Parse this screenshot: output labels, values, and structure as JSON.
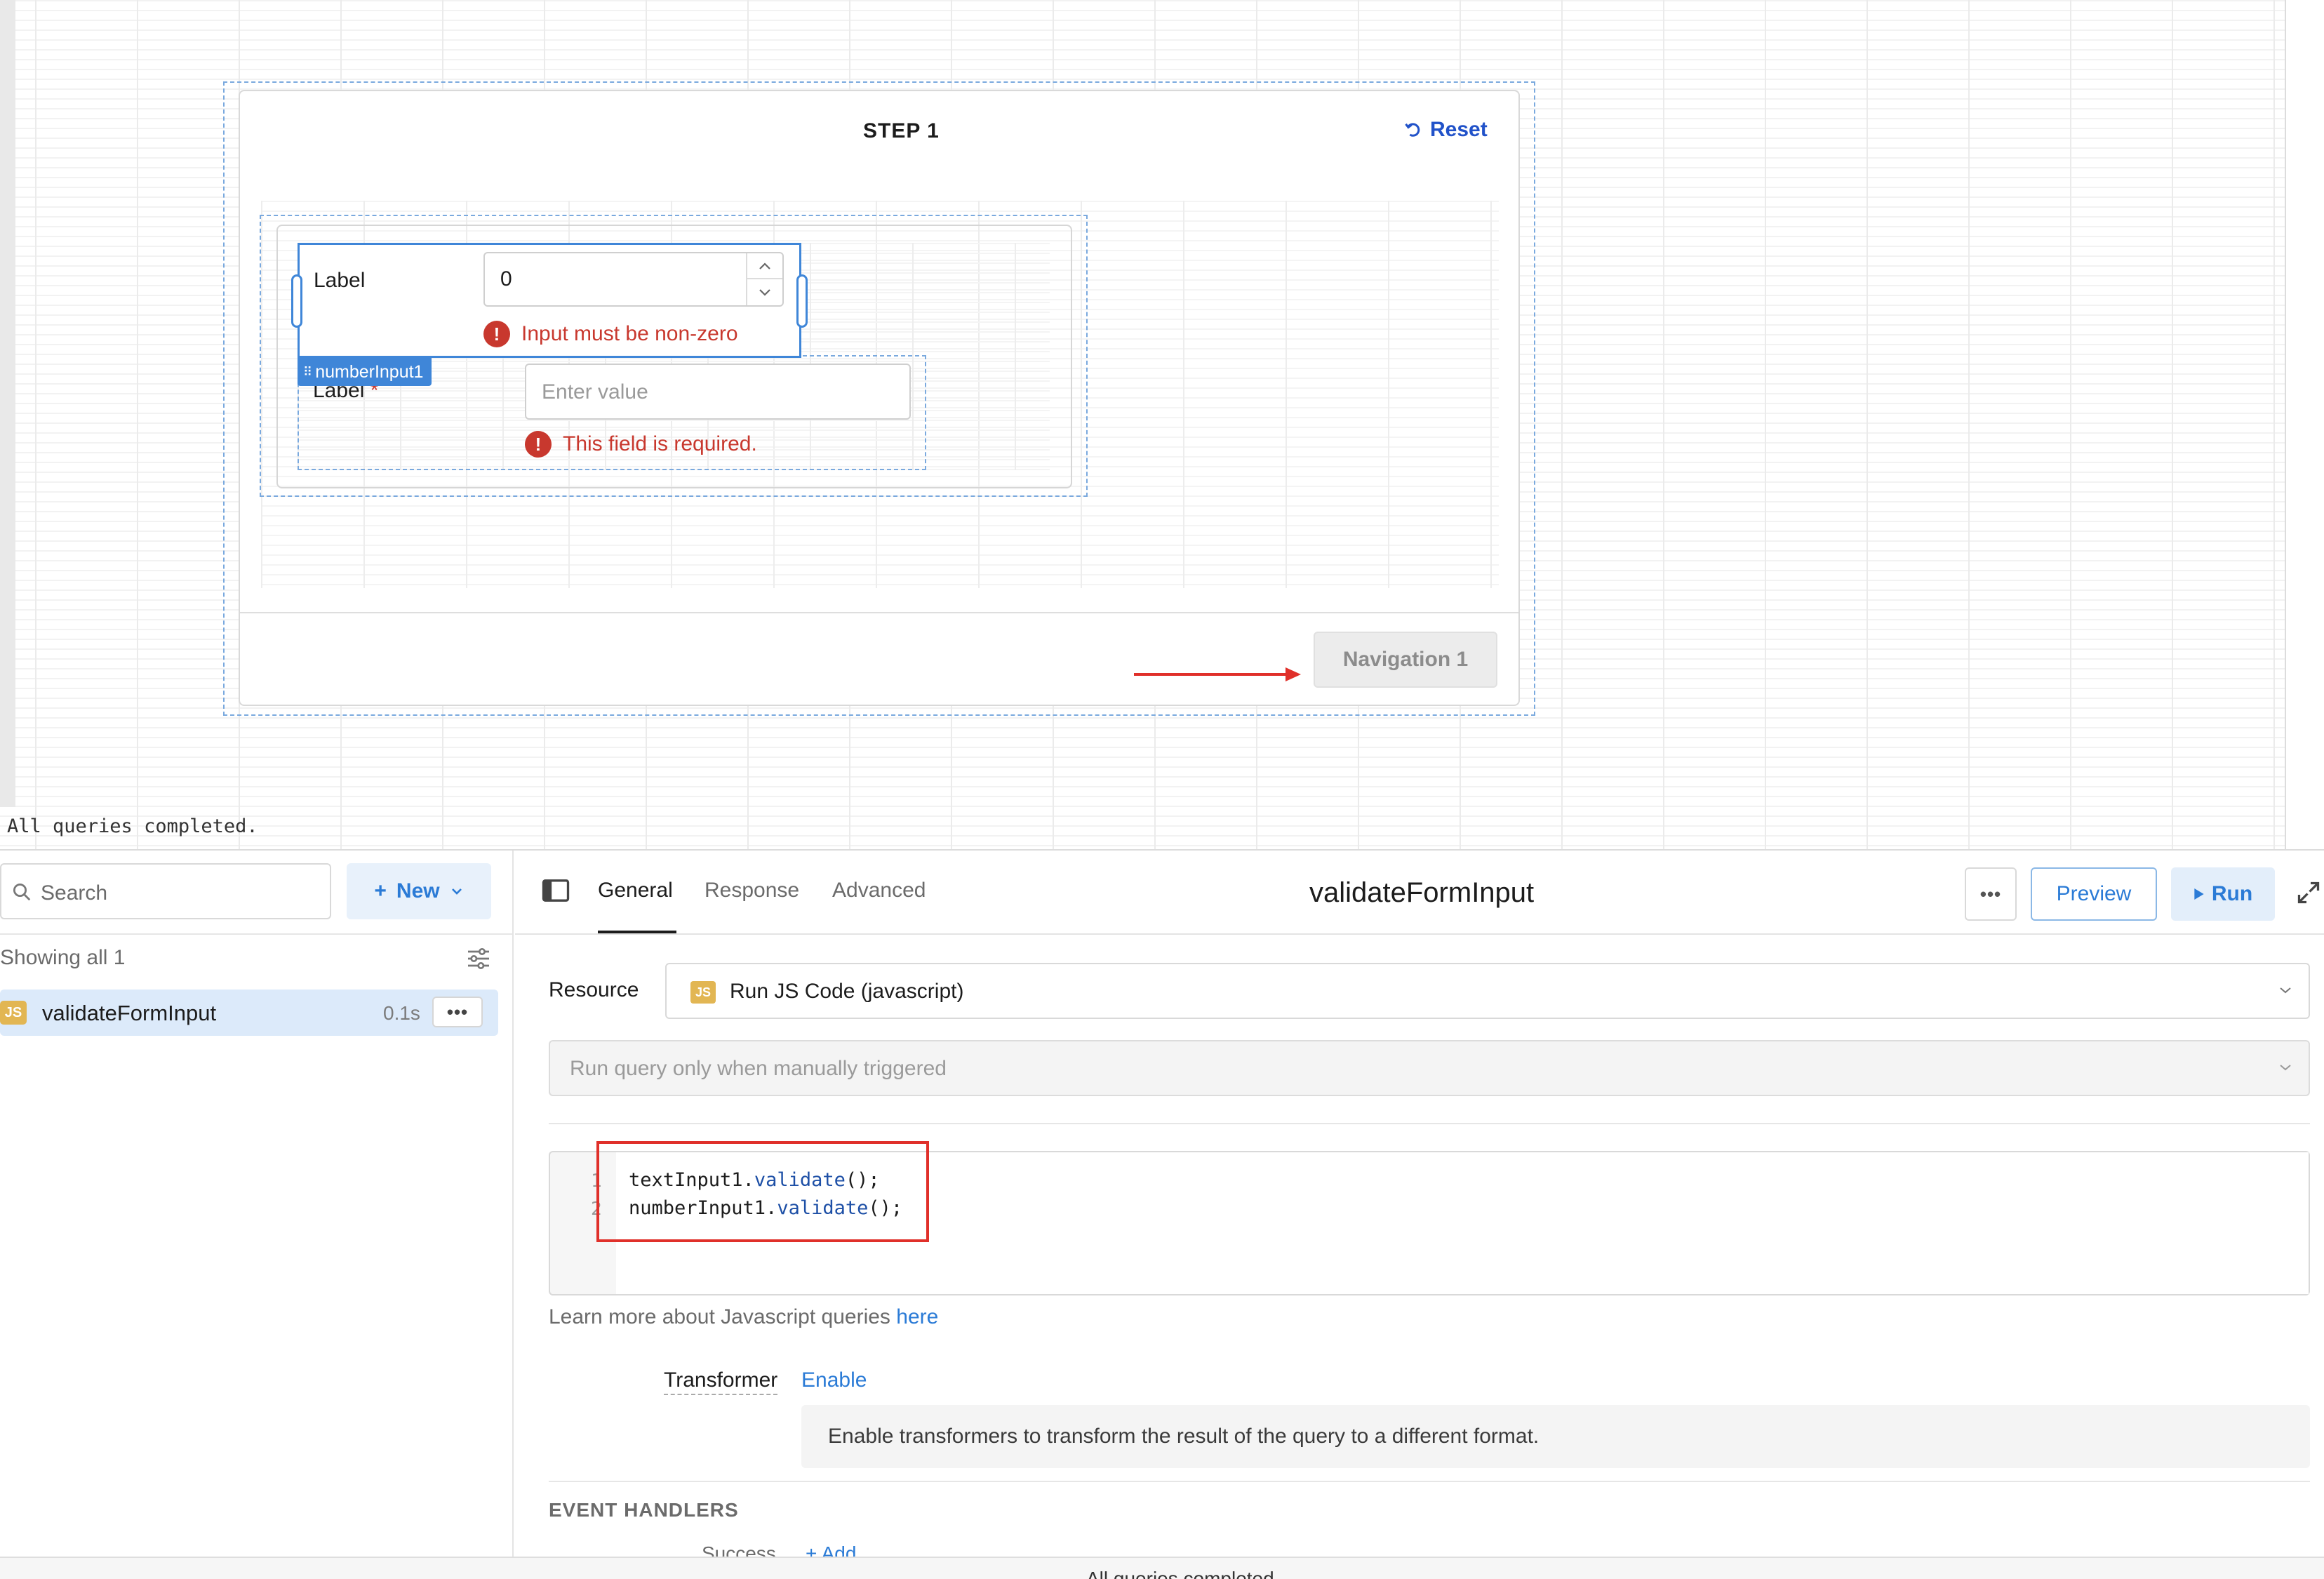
{
  "canvas": {
    "step_title": "STEP 1",
    "reset_label": "Reset",
    "number_input": {
      "label": "Label",
      "value": "0",
      "error": "Input must be non-zero",
      "component_tag": "numberInput1"
    },
    "text_input": {
      "label": "Label",
      "required_mark": "*",
      "placeholder": "Enter value",
      "error": "This field is required."
    },
    "navigation_button": "Navigation 1",
    "status": "All queries completed."
  },
  "query_list": {
    "search_placeholder": "Search",
    "new_label": "New",
    "showing": "Showing all 1",
    "items": [
      {
        "badge": "JS",
        "name": "validateFormInput",
        "time": "0.1s"
      }
    ]
  },
  "editor": {
    "tabs": [
      "General",
      "Response",
      "Advanced"
    ],
    "active_tab": "General",
    "title": "validateFormInput",
    "preview_label": "Preview",
    "run_label": "Run",
    "resource_label": "Resource",
    "resource_badge": "JS",
    "resource_value": "Run JS Code (javascript)",
    "trigger_value": "Run query only when manually triggered",
    "code_lines": [
      {
        "num": "1",
        "obj": "textInput1",
        "dot": ".",
        "method": "validate",
        "rest": "();"
      },
      {
        "num": "2",
        "obj": "numberInput1",
        "dot": ".",
        "method": "validate",
        "rest": "();"
      }
    ],
    "learn_more_text": "Learn more about Javascript queries ",
    "learn_more_link": "here",
    "transformer_label": "Transformer",
    "transformer_enable": "Enable",
    "transformer_info": "Enable transformers to transform the result of the query to a different format.",
    "event_handlers_title": "EVENT HANDLERS",
    "success_label": "Success",
    "add_label": "+ Add"
  },
  "footer": {
    "status": "All queries completed."
  },
  "colors": {
    "accent": "#2b7bd6",
    "selection": "#3f86d8",
    "error": "#c8382e",
    "highlight_box": "#e0302a",
    "js_badge": "#e2b653"
  }
}
